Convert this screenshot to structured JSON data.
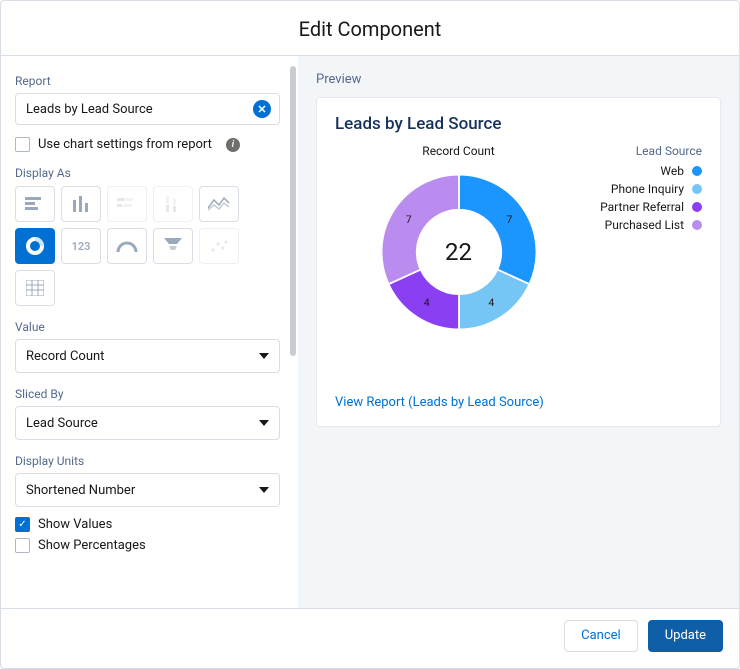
{
  "title": "Edit Component",
  "left": {
    "report_label": "Report",
    "report_value": "Leads by Lead Source",
    "use_chart_settings": "Use chart settings from report",
    "display_as_label": "Display As",
    "value_label": "Value",
    "value_selected": "Record Count",
    "sliced_by_label": "Sliced By",
    "sliced_by_selected": "Lead Source",
    "display_units_label": "Display Units",
    "display_units_selected": "Shortened Number",
    "show_values": "Show Values",
    "show_percentages": "Show Percentages"
  },
  "chart_tiles": [
    {
      "name": "hbar-icon"
    },
    {
      "name": "vbar-icon"
    },
    {
      "name": "stacked-hbar-icon"
    },
    {
      "name": "stacked-vbar-icon"
    },
    {
      "name": "line-icon"
    },
    {
      "name": "donut-icon"
    },
    {
      "name": "metric-icon"
    },
    {
      "name": "gauge-icon"
    },
    {
      "name": "funnel-icon"
    },
    {
      "name": "scatter-icon"
    },
    {
      "name": "table-icon"
    }
  ],
  "preview": {
    "label": "Preview",
    "card_title": "Leads by Lead Source",
    "chart_center_label": "Record Count",
    "legend_title": "Lead Source",
    "view_report": "View Report (Leads by Lead Source)"
  },
  "chart_data": {
    "type": "pie",
    "title": "Record Count",
    "total": 22,
    "series": [
      {
        "name": "Web",
        "value": 7,
        "color": "#1b96ff"
      },
      {
        "name": "Phone Inquiry",
        "value": 4,
        "color": "#76c6f5"
      },
      {
        "name": "Partner Referral",
        "value": 4,
        "color": "#8a3ff3"
      },
      {
        "name": "Purchased List",
        "value": 7,
        "color": "#bb8cf0"
      }
    ]
  },
  "footer": {
    "cancel": "Cancel",
    "update": "Update"
  }
}
